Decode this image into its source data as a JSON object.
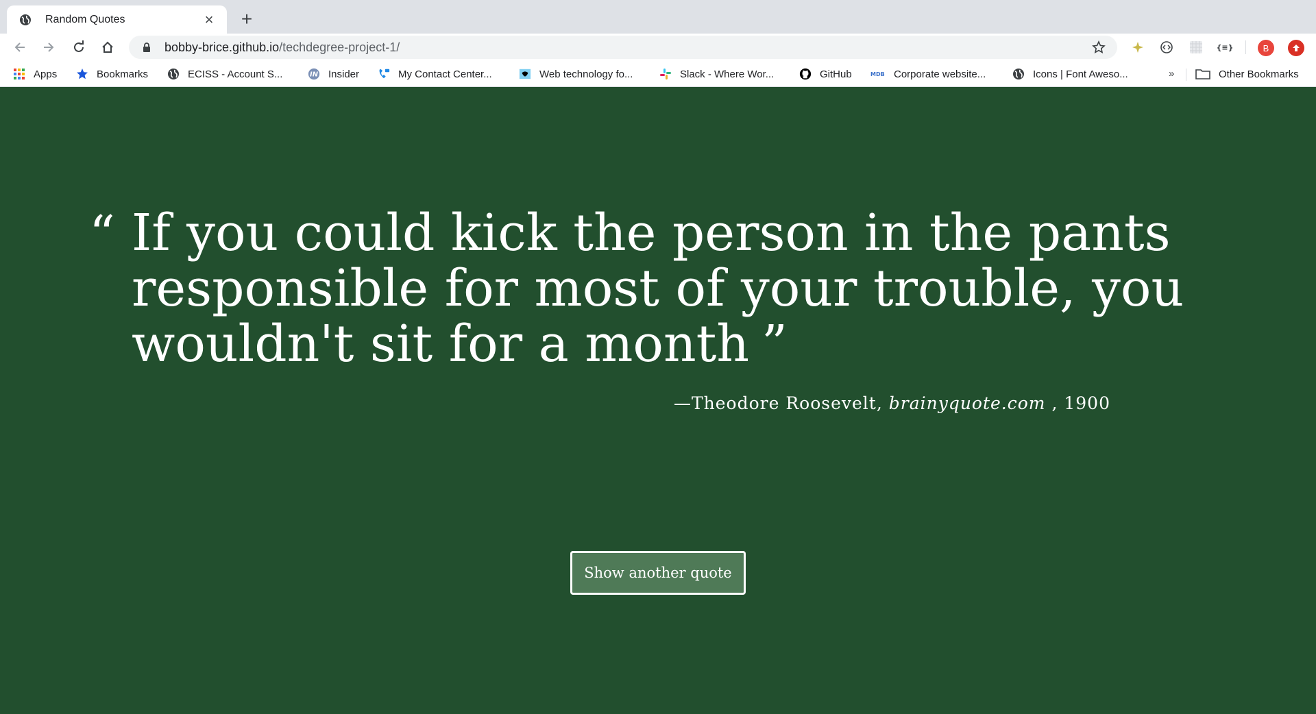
{
  "browser": {
    "tab": {
      "title": "Random Quotes",
      "favicon": "globe-icon"
    },
    "new_tab_symbol": "+",
    "close_symbol": "×",
    "url": {
      "host": "bobby-brice.github.io",
      "path": "/techdegree-project-1/"
    },
    "profile_initial": "B"
  },
  "bookmarks": {
    "items": [
      {
        "label": "Apps",
        "icon": "apps-grid-icon"
      },
      {
        "label": "Bookmarks",
        "icon": "star-icon"
      },
      {
        "label": "ECISS - Account S...",
        "icon": "globe-icon"
      },
      {
        "label": "Insider",
        "icon": "insider-icon"
      },
      {
        "label": "My Contact Center...",
        "icon": "phone-icon"
      },
      {
        "label": "Web technology fo...",
        "icon": "mdn-icon"
      },
      {
        "label": "Slack - Where Wor...",
        "icon": "slack-icon"
      },
      {
        "label": "GitHub",
        "icon": "github-icon"
      },
      {
        "label": "Corporate website...",
        "icon": "mdb-icon"
      },
      {
        "label": "Icons | Font Aweso...",
        "icon": "globe-icon"
      }
    ],
    "overflow": "»",
    "other": "Other Bookmarks"
  },
  "page": {
    "quote_open": "“",
    "quote_text": "If you could kick the person in the pants responsible for most of your trouble, you wouldn't sit for a month",
    "quote_close": "”",
    "source_prefix": "—Theodore Roosevelt, ",
    "citation": "brainyquote.com",
    "year": " , 1900",
    "button_label": "Show another quote",
    "background_color": "#224f2e",
    "button_color": "#4f7a57"
  }
}
